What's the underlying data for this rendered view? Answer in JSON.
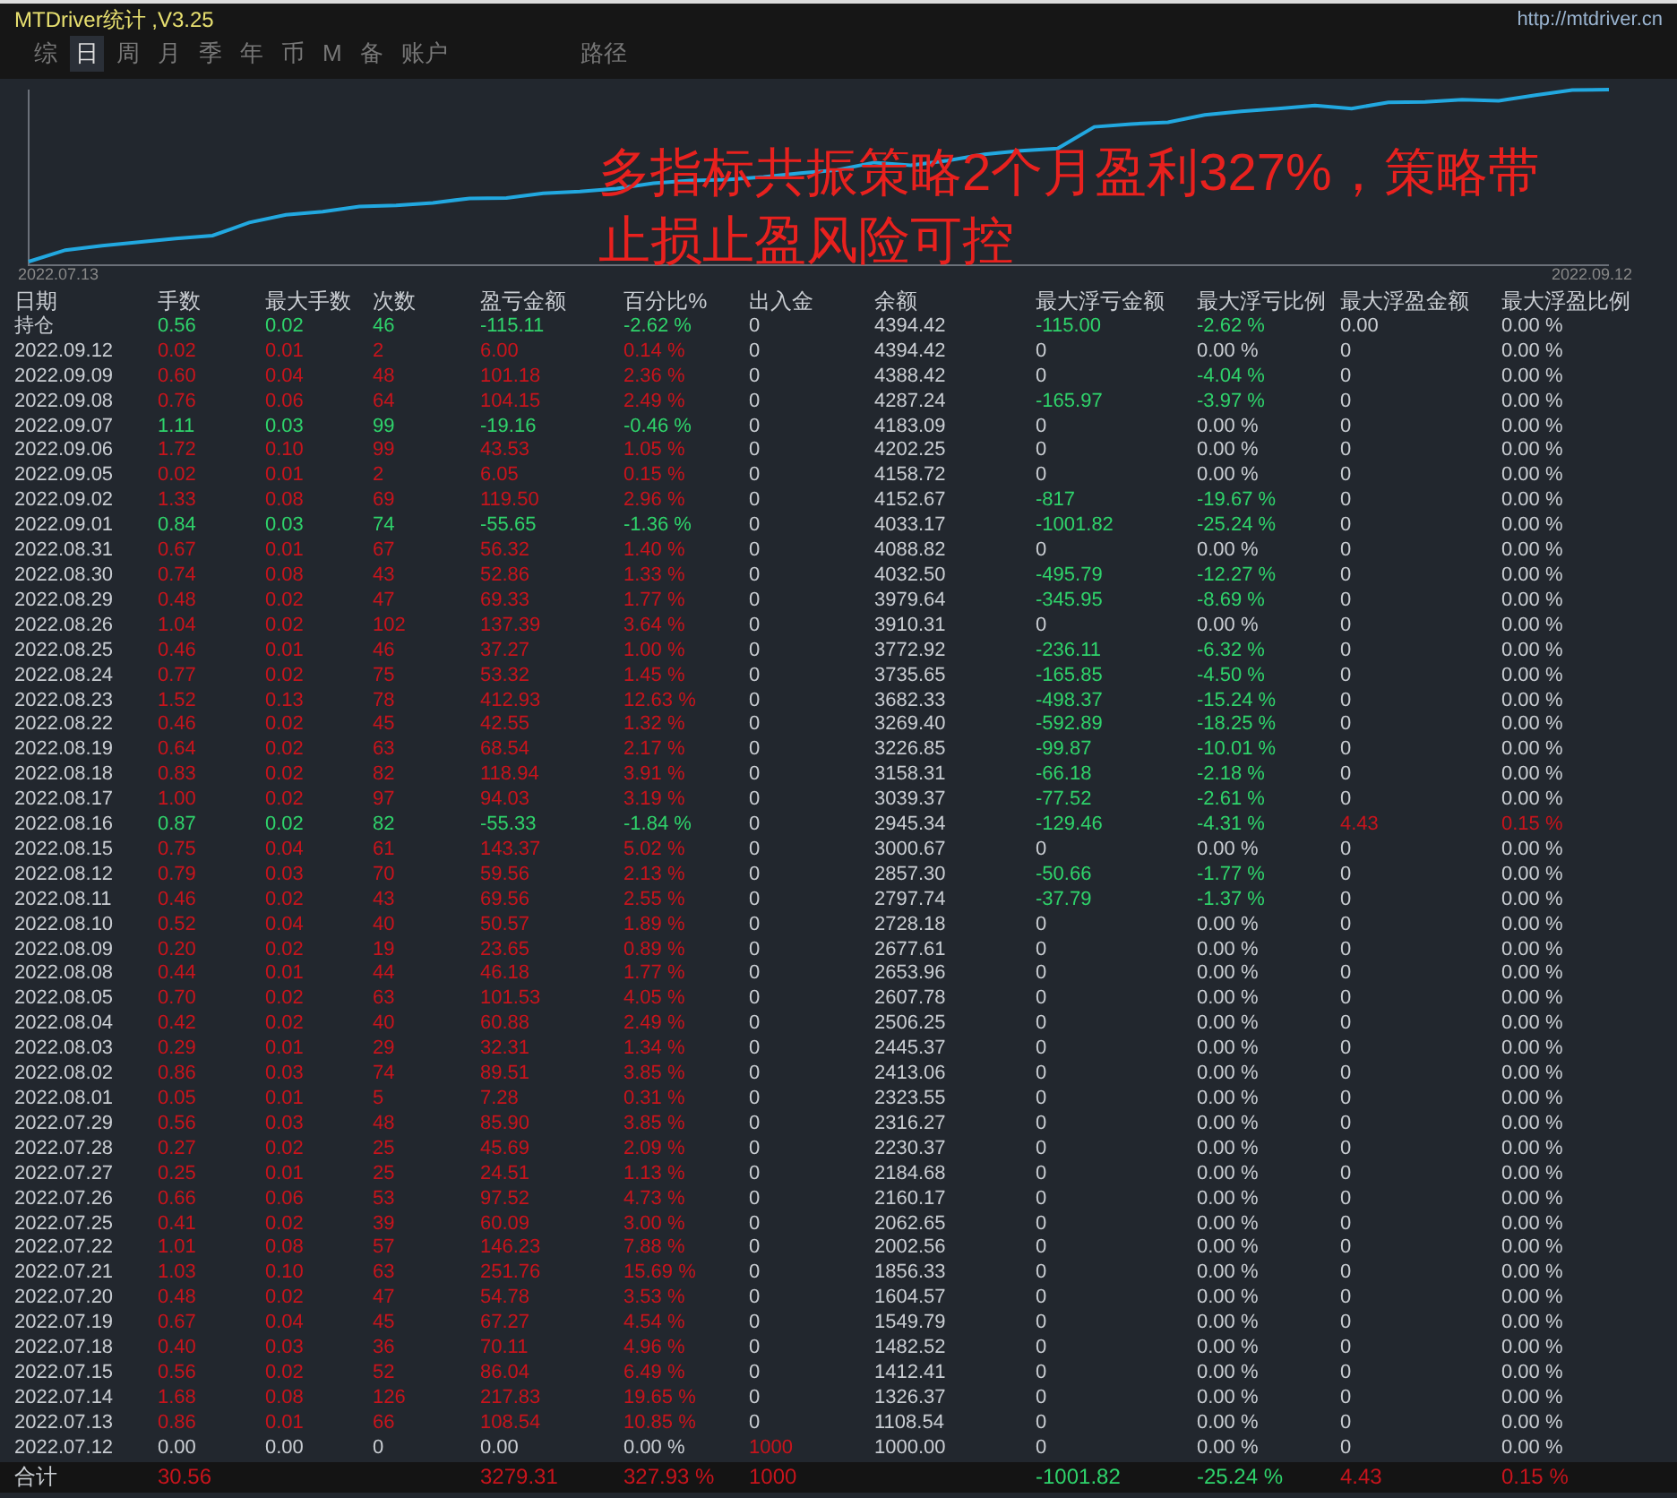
{
  "window": {
    "title": "MTDriver统计 ,V3.25",
    "link": "http://mtdriver.cn"
  },
  "tabs": [
    {
      "label": "综",
      "selected": false
    },
    {
      "label": "日",
      "selected": true
    },
    {
      "label": "周",
      "selected": false
    },
    {
      "label": "月",
      "selected": false
    },
    {
      "label": "季",
      "selected": false
    },
    {
      "label": "年",
      "selected": false
    },
    {
      "label": "币",
      "selected": false
    },
    {
      "label": "M",
      "selected": false
    },
    {
      "label": "备",
      "selected": false
    },
    {
      "label": "账户",
      "selected": false
    }
  ],
  "path_button": "路径",
  "chart": {
    "start_label": "2022.07.13",
    "end_label": "2022.09.12"
  },
  "overlay_caption": [
    "多指标共振策略2个月盈利327%，策略带",
    "止损止盈风险可控"
  ],
  "table": {
    "columns": [
      "日期",
      "手数",
      "最大手数",
      "次数",
      "盈亏金额",
      "百分比%",
      "出入金",
      "余额",
      "最大浮亏金额",
      "最大浮亏比例",
      "最大浮盈金额",
      "最大浮盈比例"
    ],
    "rows": [
      {
        "cells": [
          "持仓",
          "0.56",
          "0.02",
          "46",
          "-115.11",
          "-2.62 %",
          "0",
          "4394.42",
          "-115.00",
          "-2.62 %",
          "0.00",
          "0.00 %"
        ],
        "color": "#2fd36b",
        "dd_amount": true,
        "dd_ratio": true,
        "float_profit": false,
        "deposit": false
      },
      {
        "cells": [
          "2022.09.12",
          "0.02",
          "0.01",
          "2",
          "6.00",
          "0.14 %",
          "0",
          "4394.42",
          "0",
          "0.00 %",
          "0",
          "0.00 %"
        ],
        "color": "#c8141c",
        "dd_amount": false,
        "dd_ratio": false,
        "float_profit": false,
        "deposit": false
      },
      {
        "cells": [
          "2022.09.09",
          "0.60",
          "0.04",
          "48",
          "101.18",
          "2.36 %",
          "0",
          "4388.42",
          "0",
          "-4.04 %",
          "0",
          "0.00 %"
        ],
        "color": "#c8141c",
        "dd_amount": false,
        "dd_ratio": true,
        "float_profit": false,
        "deposit": false
      },
      {
        "cells": [
          "2022.09.08",
          "0.76",
          "0.06",
          "64",
          "104.15",
          "2.49 %",
          "0",
          "4287.24",
          "-165.97",
          "-3.97 %",
          "0",
          "0.00 %"
        ],
        "color": "#c8141c",
        "dd_amount": true,
        "dd_ratio": true,
        "float_profit": false,
        "deposit": false
      },
      {
        "cells": [
          "2022.09.07",
          "1.11",
          "0.03",
          "99",
          "-19.16",
          "-0.46 %",
          "0",
          "4183.09",
          "0",
          "0.00 %",
          "0",
          "0.00 %"
        ],
        "color": "#2fd36b",
        "dd_amount": false,
        "dd_ratio": false,
        "float_profit": false,
        "deposit": false
      },
      {
        "cells": [
          "2022.09.06",
          "1.72",
          "0.10",
          "99",
          "43.53",
          "1.05 %",
          "0",
          "4202.25",
          "0",
          "0.00 %",
          "0",
          "0.00 %"
        ],
        "color": "#c8141c",
        "dd_amount": false,
        "dd_ratio": false,
        "float_profit": false,
        "deposit": false
      },
      {
        "cells": [
          "2022.09.05",
          "0.02",
          "0.01",
          "2",
          "6.05",
          "0.15 %",
          "0",
          "4158.72",
          "0",
          "0.00 %",
          "0",
          "0.00 %"
        ],
        "color": "#c8141c",
        "dd_amount": false,
        "dd_ratio": false,
        "float_profit": false,
        "deposit": false
      },
      {
        "cells": [
          "2022.09.02",
          "1.33",
          "0.08",
          "69",
          "119.50",
          "2.96 %",
          "0",
          "4152.67",
          "-817",
          "-19.67 %",
          "0",
          "0.00 %"
        ],
        "color": "#c8141c",
        "dd_amount": true,
        "dd_ratio": true,
        "float_profit": false,
        "deposit": false
      },
      {
        "cells": [
          "2022.09.01",
          "0.84",
          "0.03",
          "74",
          "-55.65",
          "-1.36 %",
          "0",
          "4033.17",
          "-1001.82",
          "-25.24 %",
          "0",
          "0.00 %"
        ],
        "color": "#2fd36b",
        "dd_amount": true,
        "dd_ratio": true,
        "float_profit": false,
        "deposit": false
      },
      {
        "cells": [
          "2022.08.31",
          "0.67",
          "0.01",
          "67",
          "56.32",
          "1.40 %",
          "0",
          "4088.82",
          "0",
          "0.00 %",
          "0",
          "0.00 %"
        ],
        "color": "#c8141c",
        "dd_amount": false,
        "dd_ratio": false,
        "float_profit": false,
        "deposit": false
      },
      {
        "cells": [
          "2022.08.30",
          "0.74",
          "0.08",
          "43",
          "52.86",
          "1.33 %",
          "0",
          "4032.50",
          "-495.79",
          "-12.27 %",
          "0",
          "0.00 %"
        ],
        "color": "#c8141c",
        "dd_amount": true,
        "dd_ratio": true,
        "float_profit": false,
        "deposit": false
      },
      {
        "cells": [
          "2022.08.29",
          "0.48",
          "0.02",
          "47",
          "69.33",
          "1.77 %",
          "0",
          "3979.64",
          "-345.95",
          "-8.69 %",
          "0",
          "0.00 %"
        ],
        "color": "#c8141c",
        "dd_amount": true,
        "dd_ratio": true,
        "float_profit": false,
        "deposit": false
      },
      {
        "cells": [
          "2022.08.26",
          "1.04",
          "0.02",
          "102",
          "137.39",
          "3.64 %",
          "0",
          "3910.31",
          "0",
          "0.00 %",
          "0",
          "0.00 %"
        ],
        "color": "#c8141c",
        "dd_amount": false,
        "dd_ratio": false,
        "float_profit": false,
        "deposit": false
      },
      {
        "cells": [
          "2022.08.25",
          "0.46",
          "0.01",
          "46",
          "37.27",
          "1.00 %",
          "0",
          "3772.92",
          "-236.11",
          "-6.32 %",
          "0",
          "0.00 %"
        ],
        "color": "#c8141c",
        "dd_amount": true,
        "dd_ratio": true,
        "float_profit": false,
        "deposit": false
      },
      {
        "cells": [
          "2022.08.24",
          "0.77",
          "0.02",
          "75",
          "53.32",
          "1.45 %",
          "0",
          "3735.65",
          "-165.85",
          "-4.50 %",
          "0",
          "0.00 %"
        ],
        "color": "#c8141c",
        "dd_amount": true,
        "dd_ratio": true,
        "float_profit": false,
        "deposit": false
      },
      {
        "cells": [
          "2022.08.23",
          "1.52",
          "0.13",
          "78",
          "412.93",
          "12.63 %",
          "0",
          "3682.33",
          "-498.37",
          "-15.24 %",
          "0",
          "0.00 %"
        ],
        "color": "#c8141c",
        "dd_amount": true,
        "dd_ratio": true,
        "float_profit": false,
        "deposit": false
      },
      {
        "cells": [
          "2022.08.22",
          "0.46",
          "0.02",
          "45",
          "42.55",
          "1.32 %",
          "0",
          "3269.40",
          "-592.89",
          "-18.25 %",
          "0",
          "0.00 %"
        ],
        "color": "#c8141c",
        "dd_amount": true,
        "dd_ratio": true,
        "float_profit": false,
        "deposit": false
      },
      {
        "cells": [
          "2022.08.19",
          "0.64",
          "0.02",
          "63",
          "68.54",
          "2.17 %",
          "0",
          "3226.85",
          "-99.87",
          "-10.01 %",
          "0",
          "0.00 %"
        ],
        "color": "#c8141c",
        "dd_amount": true,
        "dd_ratio": true,
        "float_profit": false,
        "deposit": false
      },
      {
        "cells": [
          "2022.08.18",
          "0.83",
          "0.02",
          "82",
          "118.94",
          "3.91 %",
          "0",
          "3158.31",
          "-66.18",
          "-2.18 %",
          "0",
          "0.00 %"
        ],
        "color": "#c8141c",
        "dd_amount": true,
        "dd_ratio": true,
        "float_profit": false,
        "deposit": false
      },
      {
        "cells": [
          "2022.08.17",
          "1.00",
          "0.02",
          "97",
          "94.03",
          "3.19 %",
          "0",
          "3039.37",
          "-77.52",
          "-2.61 %",
          "0",
          "0.00 %"
        ],
        "color": "#c8141c",
        "dd_amount": true,
        "dd_ratio": true,
        "float_profit": false,
        "deposit": false
      },
      {
        "cells": [
          "2022.08.16",
          "0.87",
          "0.02",
          "82",
          "-55.33",
          "-1.84 %",
          "0",
          "2945.34",
          "-129.46",
          "-4.31 %",
          "4.43",
          "0.15 %"
        ],
        "color": "#2fd36b",
        "dd_amount": true,
        "dd_ratio": true,
        "float_profit": true,
        "deposit": false
      },
      {
        "cells": [
          "2022.08.15",
          "0.75",
          "0.04",
          "61",
          "143.37",
          "5.02 %",
          "0",
          "3000.67",
          "0",
          "0.00 %",
          "0",
          "0.00 %"
        ],
        "color": "#c8141c",
        "dd_amount": false,
        "dd_ratio": false,
        "float_profit": false,
        "deposit": false
      },
      {
        "cells": [
          "2022.08.12",
          "0.79",
          "0.03",
          "70",
          "59.56",
          "2.13 %",
          "0",
          "2857.30",
          "-50.66",
          "-1.77 %",
          "0",
          "0.00 %"
        ],
        "color": "#c8141c",
        "dd_amount": true,
        "dd_ratio": true,
        "float_profit": false,
        "deposit": false
      },
      {
        "cells": [
          "2022.08.11",
          "0.46",
          "0.02",
          "43",
          "69.56",
          "2.55 %",
          "0",
          "2797.74",
          "-37.79",
          "-1.37 %",
          "0",
          "0.00 %"
        ],
        "color": "#c8141c",
        "dd_amount": true,
        "dd_ratio": true,
        "float_profit": false,
        "deposit": false
      },
      {
        "cells": [
          "2022.08.10",
          "0.52",
          "0.04",
          "40",
          "50.57",
          "1.89 %",
          "0",
          "2728.18",
          "0",
          "0.00 %",
          "0",
          "0.00 %"
        ],
        "color": "#c8141c",
        "dd_amount": false,
        "dd_ratio": false,
        "float_profit": false,
        "deposit": false
      },
      {
        "cells": [
          "2022.08.09",
          "0.20",
          "0.02",
          "19",
          "23.65",
          "0.89 %",
          "0",
          "2677.61",
          "0",
          "0.00 %",
          "0",
          "0.00 %"
        ],
        "color": "#c8141c",
        "dd_amount": false,
        "dd_ratio": false,
        "float_profit": false,
        "deposit": false
      },
      {
        "cells": [
          "2022.08.08",
          "0.44",
          "0.01",
          "44",
          "46.18",
          "1.77 %",
          "0",
          "2653.96",
          "0",
          "0.00 %",
          "0",
          "0.00 %"
        ],
        "color": "#c8141c",
        "dd_amount": false,
        "dd_ratio": false,
        "float_profit": false,
        "deposit": false
      },
      {
        "cells": [
          "2022.08.05",
          "0.70",
          "0.02",
          "63",
          "101.53",
          "4.05 %",
          "0",
          "2607.78",
          "0",
          "0.00 %",
          "0",
          "0.00 %"
        ],
        "color": "#c8141c",
        "dd_amount": false,
        "dd_ratio": false,
        "float_profit": false,
        "deposit": false
      },
      {
        "cells": [
          "2022.08.04",
          "0.42",
          "0.02",
          "40",
          "60.88",
          "2.49 %",
          "0",
          "2506.25",
          "0",
          "0.00 %",
          "0",
          "0.00 %"
        ],
        "color": "#c8141c",
        "dd_amount": false,
        "dd_ratio": false,
        "float_profit": false,
        "deposit": false
      },
      {
        "cells": [
          "2022.08.03",
          "0.29",
          "0.01",
          "29",
          "32.31",
          "1.34 %",
          "0",
          "2445.37",
          "0",
          "0.00 %",
          "0",
          "0.00 %"
        ],
        "color": "#c8141c",
        "dd_amount": false,
        "dd_ratio": false,
        "float_profit": false,
        "deposit": false
      },
      {
        "cells": [
          "2022.08.02",
          "0.86",
          "0.03",
          "74",
          "89.51",
          "3.85 %",
          "0",
          "2413.06",
          "0",
          "0.00 %",
          "0",
          "0.00 %"
        ],
        "color": "#c8141c",
        "dd_amount": false,
        "dd_ratio": false,
        "float_profit": false,
        "deposit": false
      },
      {
        "cells": [
          "2022.08.01",
          "0.05",
          "0.01",
          "5",
          "7.28",
          "0.31 %",
          "0",
          "2323.55",
          "0",
          "0.00 %",
          "0",
          "0.00 %"
        ],
        "color": "#c8141c",
        "dd_amount": false,
        "dd_ratio": false,
        "float_profit": false,
        "deposit": false
      },
      {
        "cells": [
          "2022.07.29",
          "0.56",
          "0.03",
          "48",
          "85.90",
          "3.85 %",
          "0",
          "2316.27",
          "0",
          "0.00 %",
          "0",
          "0.00 %"
        ],
        "color": "#c8141c",
        "dd_amount": false,
        "dd_ratio": false,
        "float_profit": false,
        "deposit": false
      },
      {
        "cells": [
          "2022.07.28",
          "0.27",
          "0.02",
          "25",
          "45.69",
          "2.09 %",
          "0",
          "2230.37",
          "0",
          "0.00 %",
          "0",
          "0.00 %"
        ],
        "color": "#c8141c",
        "dd_amount": false,
        "dd_ratio": false,
        "float_profit": false,
        "deposit": false
      },
      {
        "cells": [
          "2022.07.27",
          "0.25",
          "0.01",
          "25",
          "24.51",
          "1.13 %",
          "0",
          "2184.68",
          "0",
          "0.00 %",
          "0",
          "0.00 %"
        ],
        "color": "#c8141c",
        "dd_amount": false,
        "dd_ratio": false,
        "float_profit": false,
        "deposit": false
      },
      {
        "cells": [
          "2022.07.26",
          "0.66",
          "0.06",
          "53",
          "97.52",
          "4.73 %",
          "0",
          "2160.17",
          "0",
          "0.00 %",
          "0",
          "0.00 %"
        ],
        "color": "#c8141c",
        "dd_amount": false,
        "dd_ratio": false,
        "float_profit": false,
        "deposit": false
      },
      {
        "cells": [
          "2022.07.25",
          "0.41",
          "0.02",
          "39",
          "60.09",
          "3.00 %",
          "0",
          "2062.65",
          "0",
          "0.00 %",
          "0",
          "0.00 %"
        ],
        "color": "#c8141c",
        "dd_amount": false,
        "dd_ratio": false,
        "float_profit": false,
        "deposit": false
      },
      {
        "cells": [
          "2022.07.22",
          "1.01",
          "0.08",
          "57",
          "146.23",
          "7.88 %",
          "0",
          "2002.56",
          "0",
          "0.00 %",
          "0",
          "0.00 %"
        ],
        "color": "#c8141c",
        "dd_amount": false,
        "dd_ratio": false,
        "float_profit": false,
        "deposit": false
      },
      {
        "cells": [
          "2022.07.21",
          "1.03",
          "0.10",
          "63",
          "251.76",
          "15.69 %",
          "0",
          "1856.33",
          "0",
          "0.00 %",
          "0",
          "0.00 %"
        ],
        "color": "#c8141c",
        "dd_amount": false,
        "dd_ratio": false,
        "float_profit": false,
        "deposit": false
      },
      {
        "cells": [
          "2022.07.20",
          "0.48",
          "0.02",
          "47",
          "54.78",
          "3.53 %",
          "0",
          "1604.57",
          "0",
          "0.00 %",
          "0",
          "0.00 %"
        ],
        "color": "#c8141c",
        "dd_amount": false,
        "dd_ratio": false,
        "float_profit": false,
        "deposit": false
      },
      {
        "cells": [
          "2022.07.19",
          "0.67",
          "0.04",
          "45",
          "67.27",
          "4.54 %",
          "0",
          "1549.79",
          "0",
          "0.00 %",
          "0",
          "0.00 %"
        ],
        "color": "#c8141c",
        "dd_amount": false,
        "dd_ratio": false,
        "float_profit": false,
        "deposit": false
      },
      {
        "cells": [
          "2022.07.18",
          "0.40",
          "0.03",
          "36",
          "70.11",
          "4.96 %",
          "0",
          "1482.52",
          "0",
          "0.00 %",
          "0",
          "0.00 %"
        ],
        "color": "#c8141c",
        "dd_amount": false,
        "dd_ratio": false,
        "float_profit": false,
        "deposit": false
      },
      {
        "cells": [
          "2022.07.15",
          "0.56",
          "0.02",
          "52",
          "86.04",
          "6.49 %",
          "0",
          "1412.41",
          "0",
          "0.00 %",
          "0",
          "0.00 %"
        ],
        "color": "#c8141c",
        "dd_amount": false,
        "dd_ratio": false,
        "float_profit": false,
        "deposit": false
      },
      {
        "cells": [
          "2022.07.14",
          "1.68",
          "0.08",
          "126",
          "217.83",
          "19.65 %",
          "0",
          "1326.37",
          "0",
          "0.00 %",
          "0",
          "0.00 %"
        ],
        "color": "#c8141c",
        "dd_amount": false,
        "dd_ratio": false,
        "float_profit": false,
        "deposit": false
      },
      {
        "cells": [
          "2022.07.13",
          "0.86",
          "0.01",
          "66",
          "108.54",
          "10.85 %",
          "0",
          "1108.54",
          "0",
          "0.00 %",
          "0",
          "0.00 %"
        ],
        "color": "#c8141c",
        "dd_amount": false,
        "dd_ratio": false,
        "float_profit": false,
        "deposit": false
      },
      {
        "cells": [
          "2022.07.12",
          "0.00",
          "0.00",
          "0",
          "0.00",
          "0.00 %",
          "1000",
          "1000.00",
          "0",
          "0.00 %",
          "0",
          "0.00 %"
        ],
        "color": "#c9cdd2",
        "dd_amount": false,
        "dd_ratio": false,
        "float_profit": false,
        "deposit": true
      }
    ],
    "total": {
      "cells": [
        "合计",
        "30.56",
        "",
        "",
        "3279.31",
        "327.93 %",
        "1000",
        "",
        "-1001.82",
        "-25.24 %",
        "4.43",
        "0.15 %"
      ],
      "color": "#c8141c",
      "dd_amount": true,
      "dd_ratio": true,
      "float_profit": true,
      "deposit": true
    }
  }
}
